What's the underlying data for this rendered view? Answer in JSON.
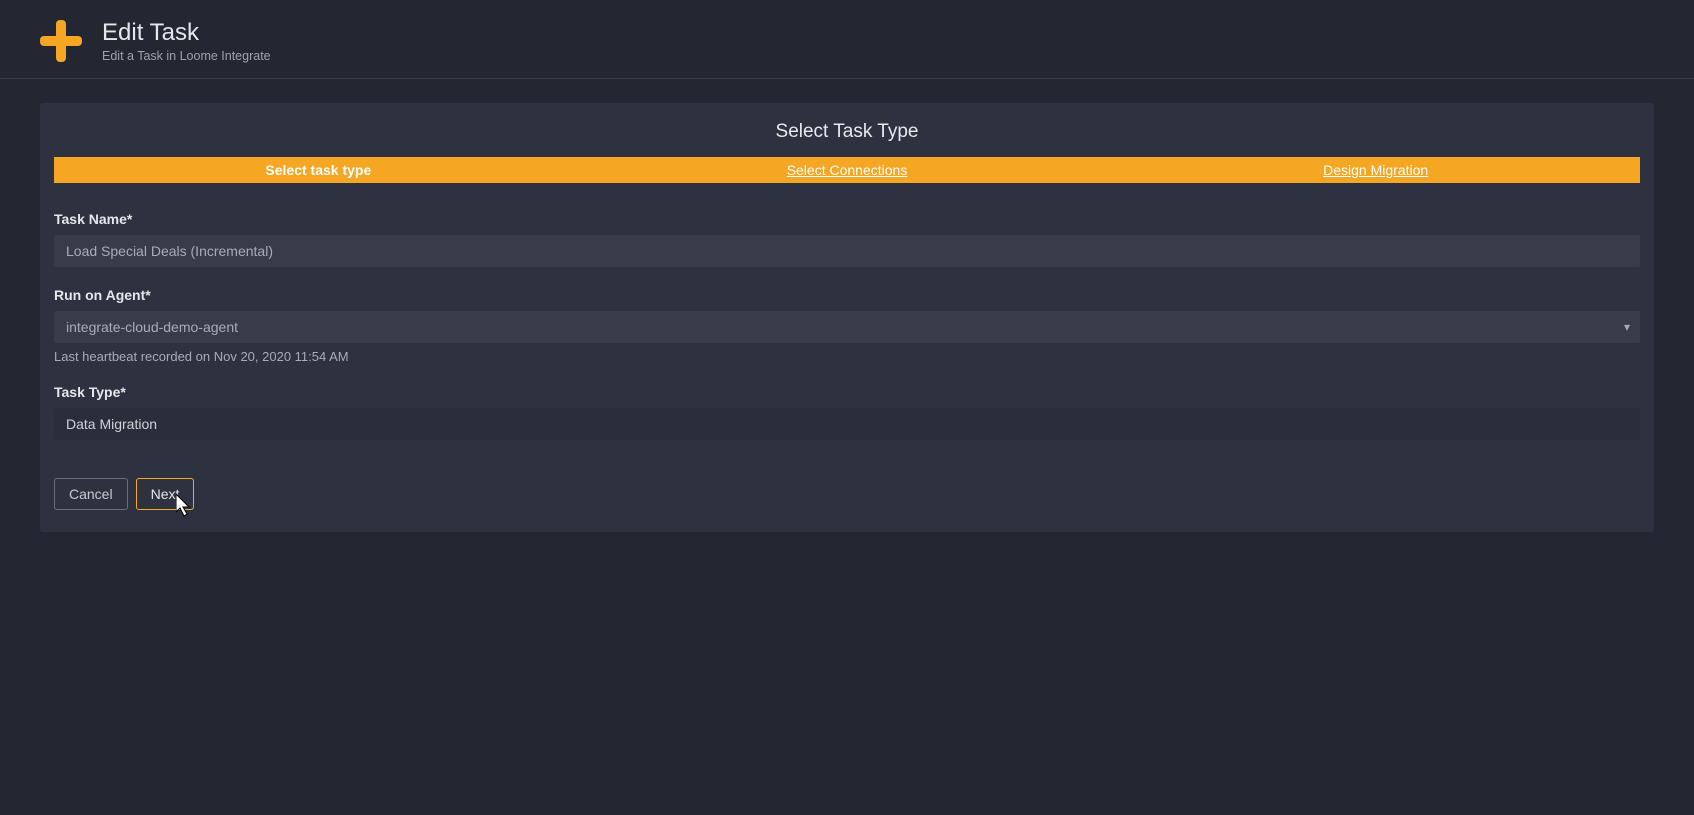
{
  "header": {
    "title": "Edit Task",
    "subtitle": "Edit a Task in Loome Integrate"
  },
  "panel": {
    "title": "Select Task Type"
  },
  "tabs": {
    "select_task_type": "Select task type",
    "select_connections": "Select Connections",
    "design_migration": "Design Migration"
  },
  "form": {
    "task_name_label": "Task Name*",
    "task_name_value": "Load Special Deals (Incremental)",
    "agent_label": "Run on Agent*",
    "agent_value": "integrate-cloud-demo-agent",
    "agent_helper": "Last heartbeat recorded on Nov 20, 2020 11:54 AM",
    "task_type_label": "Task Type*",
    "task_type_value": "Data Migration"
  },
  "buttons": {
    "cancel": "Cancel",
    "next": "Next"
  }
}
